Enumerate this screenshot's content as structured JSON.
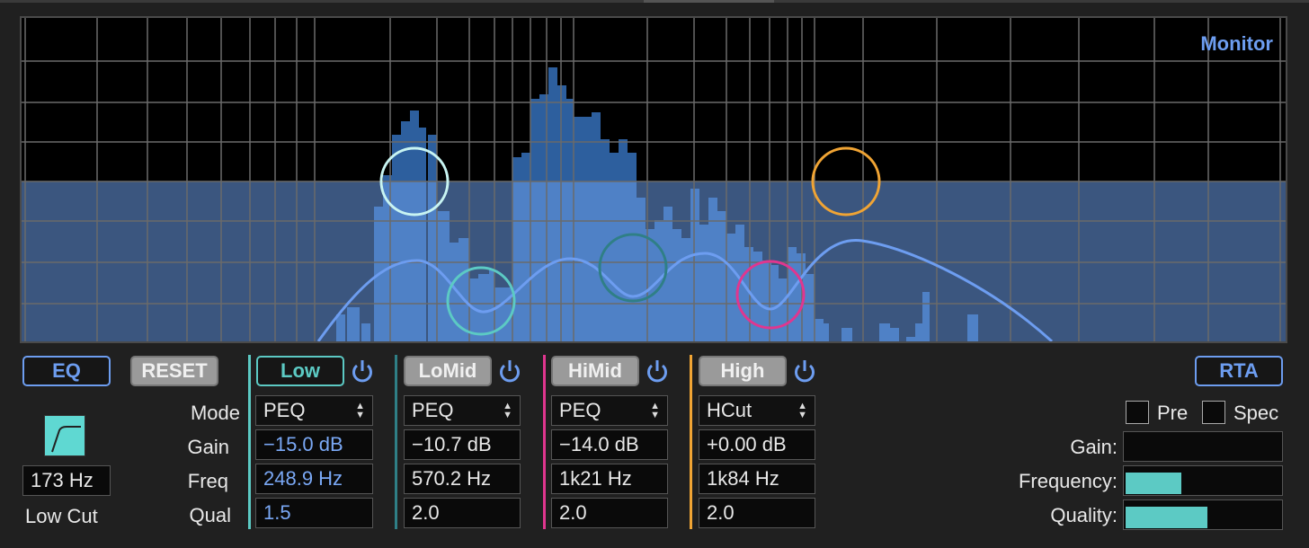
{
  "graph": {
    "monitor_label": "Monitor"
  },
  "left": {
    "eq_label": "EQ",
    "reset_label": "RESET",
    "lowcut_freq": "173 Hz",
    "lowcut_label": "Low Cut",
    "row_labels": {
      "mode": "Mode",
      "gain": "Gain",
      "freq": "Freq",
      "qual": "Qual"
    }
  },
  "bands": [
    {
      "name": "Low",
      "mode": "PEQ",
      "gain": "−15.0 dB",
      "freq": "248.9 Hz",
      "qual": "1.5",
      "color": "#5ccac4"
    },
    {
      "name": "LoMid",
      "mode": "PEQ",
      "gain": "−10.7 dB",
      "freq": "570.2 Hz",
      "qual": "2.0",
      "color": "#2f7f86"
    },
    {
      "name": "HiMid",
      "mode": "PEQ",
      "gain": "−14.0 dB",
      "freq": "1k21 Hz",
      "qual": "2.0",
      "color": "#e0368f"
    },
    {
      "name": "High",
      "mode": "HCut",
      "gain": "+0.00 dB",
      "freq": "1k84 Hz",
      "qual": "2.0",
      "color": "#f0a434"
    }
  ],
  "rta": {
    "label": "RTA",
    "pre_label": "Pre",
    "spec_label": "Spec",
    "gain_label": "Gain:",
    "frequency_label": "Frequency:",
    "quality_label": "Quality:",
    "gain_level": 0,
    "frequency_level": 0.36,
    "quality_level": 0.53
  },
  "colors": {
    "accent": "#6d9df0",
    "teal": "#5ccac4",
    "pink": "#e0368f",
    "orange": "#f0a434"
  }
}
